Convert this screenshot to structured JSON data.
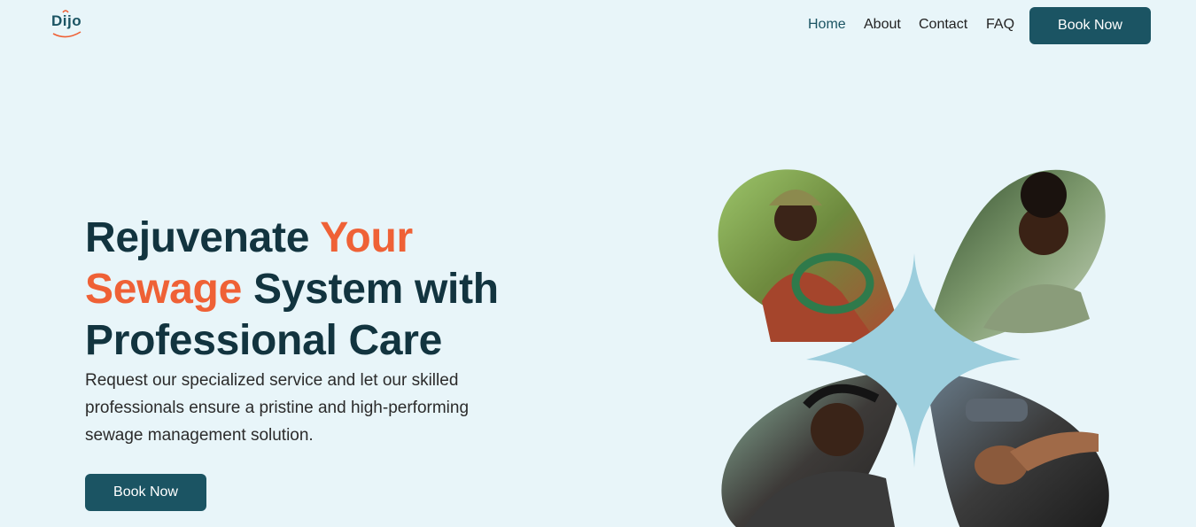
{
  "brand": {
    "name": "Dijo",
    "primary_color": "#1b5463",
    "accent_color": "#ef6136",
    "background": "#e8f5f9"
  },
  "nav": {
    "links": [
      {
        "label": "Home",
        "active": true
      },
      {
        "label": "About",
        "active": false
      },
      {
        "label": "Contact",
        "active": false
      },
      {
        "label": "FAQ",
        "active": false
      }
    ],
    "cta_label": "Book Now"
  },
  "hero": {
    "title_part1": "Rejuvenate ",
    "title_accent": "Your Sewage",
    "title_part2": " System with Professional Care",
    "subtitle": "Request our specialized service and let our skilled professionals ensure a pristine and high-performing sewage management solution.",
    "cta_label": "Book Now"
  },
  "images": {
    "top_left": "man-with-hose-photo",
    "top_right": "woman-smiling-photo",
    "bottom_left": "man-smiling-photo",
    "bottom_right": "machinery-repair-photo"
  }
}
